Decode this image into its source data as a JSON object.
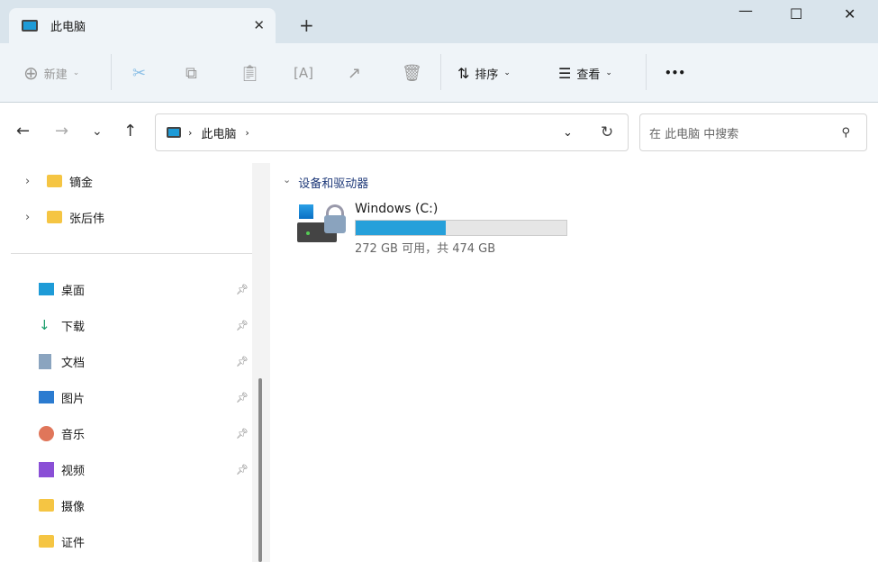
{
  "window": {
    "tab_title": "此电脑"
  },
  "toolbar": {
    "new": "新建",
    "sort": "排序",
    "view": "查看",
    "more": "•••"
  },
  "address": {
    "crumb": "此电脑",
    "search_placeholder": "在 此电脑 中搜索"
  },
  "sidebar": {
    "tree": [
      {
        "label": "镝金"
      },
      {
        "label": "张后伟"
      }
    ],
    "quick": [
      {
        "label": "桌面",
        "icon": "desktop-icon",
        "pinned": true
      },
      {
        "label": "下载",
        "icon": "download-icon",
        "pinned": true
      },
      {
        "label": "文档",
        "icon": "document-icon",
        "pinned": true
      },
      {
        "label": "图片",
        "icon": "pictures-icon",
        "pinned": true
      },
      {
        "label": "音乐",
        "icon": "music-icon",
        "pinned": true
      },
      {
        "label": "视频",
        "icon": "video-icon",
        "pinned": true
      },
      {
        "label": "摄像",
        "icon": "folder-icon",
        "pinned": false
      },
      {
        "label": "证件",
        "icon": "folder-icon",
        "pinned": false
      }
    ]
  },
  "main": {
    "group": "设备和驱动器",
    "drives": [
      {
        "name": "Windows (C:)",
        "usage_text": "272 GB 可用，共 474 GB",
        "used_fraction": 0.426,
        "bar_color": "#26a0da"
      }
    ]
  }
}
